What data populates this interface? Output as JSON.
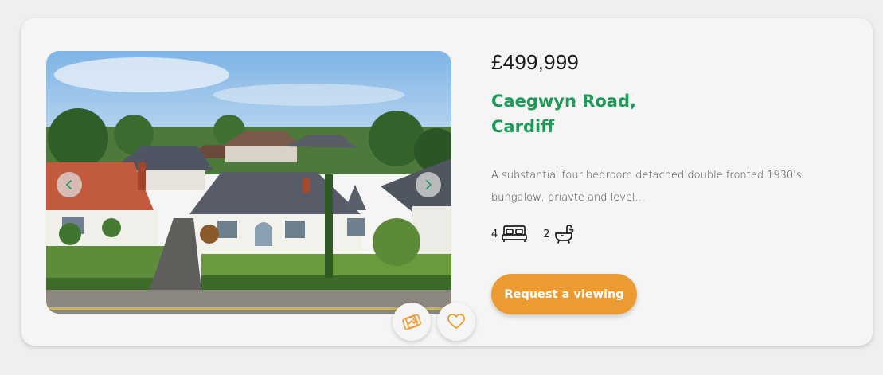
{
  "listing": {
    "price": "£499,999",
    "address_line1": "Caegwyn Road,",
    "address_line2": "Cardiff",
    "description": "A substantial four bedroom detached double fronted 1930's bungalow, priavte and level...",
    "bedrooms": "4",
    "bathrooms": "2",
    "cta_label": "Request a viewing"
  },
  "icons": {
    "prev": "chevron-left-icon",
    "next": "chevron-right-icon",
    "gallery": "photos-icon",
    "favourite": "heart-icon",
    "bed": "bed-icon",
    "bath": "bath-icon"
  },
  "colors": {
    "accent": "#ec9b33",
    "address": "#1e9a58",
    "card": "#f5f5f5",
    "background": "#efefef"
  }
}
